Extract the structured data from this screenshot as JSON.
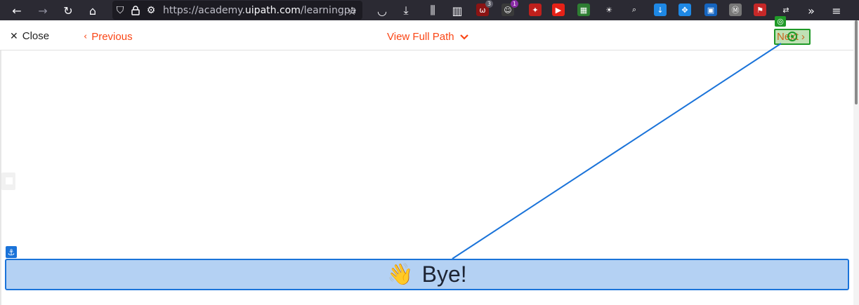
{
  "browser": {
    "url_prefix": "https://academy.",
    "url_domain": "uipath.com",
    "url_suffix": "/learningpa",
    "icons": {
      "back": "←",
      "forward": "→",
      "reload": "↻",
      "home": "⌂",
      "shield": "⛉",
      "lock": "🔒",
      "perm": "⚙",
      "star": "☆",
      "pocket": "◡",
      "download": "⤓",
      "library": "⫼",
      "sidebar": "▥",
      "overflow": "»",
      "menu": "≡"
    },
    "extensions": [
      {
        "name": "ublock-icon",
        "color": "#8b1414",
        "glyph": "ω",
        "badge": "3",
        "badge_color": "#5b5b66"
      },
      {
        "name": "tampermonkey-icon",
        "color": "#3a3a3a",
        "glyph": "☺",
        "badge": "1",
        "badge_color": "#8a2ba6"
      },
      {
        "name": "magic-wand-icon",
        "color": "#c0201c",
        "glyph": "✦",
        "badge": "",
        "badge_color": ""
      },
      {
        "name": "youtube-icon",
        "color": "#e62117",
        "glyph": "▶",
        "badge": "",
        "badge_color": ""
      },
      {
        "name": "grid-extension-icon",
        "color": "#2e7d32",
        "glyph": "▦",
        "badge": "",
        "badge_color": ""
      },
      {
        "name": "sun-icon",
        "color": "#2b2a33",
        "glyph": "☀",
        "badge": "",
        "badge_color": ""
      },
      {
        "name": "magnifier-icon",
        "color": "#2b2a33",
        "glyph": "⌕",
        "badge": "",
        "badge_color": ""
      },
      {
        "name": "download-helper-icon",
        "color": "#1e88e5",
        "glyph": "↓",
        "badge": "",
        "badge_color": ""
      },
      {
        "name": "puzzle-icon",
        "color": "#1e88e5",
        "glyph": "✥",
        "badge": "",
        "badge_color": ""
      },
      {
        "name": "clapper-icon",
        "color": "#1565c0",
        "glyph": "▣",
        "badge": "",
        "badge_color": ""
      },
      {
        "name": "grey-extension-icon",
        "color": "#777777",
        "glyph": "Ⓜ",
        "badge": "",
        "badge_color": ""
      },
      {
        "name": "red-flag-icon",
        "color": "#c62828",
        "glyph": "⚑",
        "badge": "",
        "badge_color": ""
      },
      {
        "name": "arrows-icon",
        "color": "#2b2a33",
        "glyph": "⇄",
        "badge": "",
        "badge_color": ""
      }
    ]
  },
  "nav": {
    "close_icon": "✕",
    "close_label": "Close",
    "previous_icon": "‹",
    "previous_label": "Previous",
    "path_label": "View Full Path",
    "next_label": "Next",
    "next_icon": "›",
    "next_tag_icon": "◎"
  },
  "content": {
    "anchor_icon": "⚓",
    "wave_icon": "👋",
    "bye_text": "Bye!"
  },
  "colors": {
    "accent": "#fa4616",
    "highlight_blue": "#1a73d9",
    "highlight_green": "#1f9a28"
  }
}
